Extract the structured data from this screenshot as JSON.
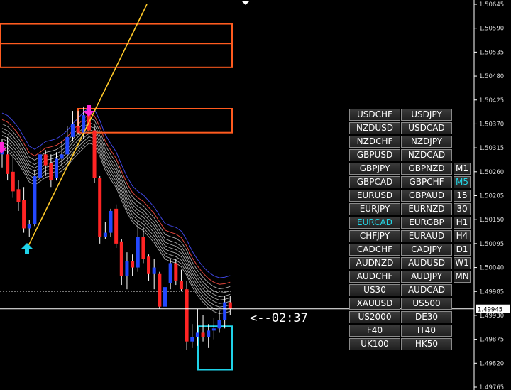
{
  "chart_data": {
    "type": "candlestick",
    "ylim": [
      1.49765,
      1.50645
    ],
    "price_axis": {
      "ticks": [
        1.50645,
        1.5059,
        1.50535,
        1.5048,
        1.50425,
        1.5037,
        1.50315,
        1.5026,
        1.50205,
        1.5015,
        1.50095,
        1.5004,
        1.49985,
        1.4993,
        1.49875,
        1.4982,
        1.49765
      ],
      "tick_labels": [
        "1.50645",
        "1.50590",
        "1.50535",
        "1.50480",
        "1.50425",
        "1.50370",
        "1.50315",
        "1.50260",
        "1.50205",
        "1.50150",
        "1.50095",
        "1.50040",
        "1.49985",
        "1.49930",
        "1.49875",
        "1.49820",
        "1.49765"
      ]
    },
    "current_price": 1.49945,
    "current_price_label": "1.49945",
    "countdown": "<--02:37",
    "candles": [
      {
        "o": 1.503,
        "h": 1.50335,
        "l": 1.5027,
        "c": 1.5032
      },
      {
        "o": 1.503,
        "h": 1.5034,
        "l": 1.5024,
        "c": 1.50255
      },
      {
        "o": 1.5026,
        "h": 1.503,
        "l": 1.502,
        "c": 1.50215
      },
      {
        "o": 1.5022,
        "h": 1.5024,
        "l": 1.5017,
        "c": 1.5019
      },
      {
        "o": 1.50195,
        "h": 1.50225,
        "l": 1.5012,
        "c": 1.5013
      },
      {
        "o": 1.5013,
        "h": 1.5015,
        "l": 1.5011,
        "c": 1.5014
      },
      {
        "o": 1.5014,
        "h": 1.50265,
        "l": 1.50135,
        "c": 1.5025
      },
      {
        "o": 1.50245,
        "h": 1.5032,
        "l": 1.5024,
        "c": 1.503
      },
      {
        "o": 1.503,
        "h": 1.5031,
        "l": 1.5025,
        "c": 1.50275
      },
      {
        "o": 1.5028,
        "h": 1.503,
        "l": 1.50225,
        "c": 1.5024
      },
      {
        "o": 1.50245,
        "h": 1.50305,
        "l": 1.5024,
        "c": 1.5029
      },
      {
        "o": 1.5029,
        "h": 1.5033,
        "l": 1.50275,
        "c": 1.503
      },
      {
        "o": 1.503,
        "h": 1.50365,
        "l": 1.5028,
        "c": 1.5034
      },
      {
        "o": 1.5034,
        "h": 1.504,
        "l": 1.5033,
        "c": 1.5037
      },
      {
        "o": 1.50365,
        "h": 1.504,
        "l": 1.50345,
        "c": 1.5035
      },
      {
        "o": 1.5035,
        "h": 1.5041,
        "l": 1.50335,
        "c": 1.5039
      },
      {
        "o": 1.5039,
        "h": 1.5041,
        "l": 1.5034,
        "c": 1.50355
      },
      {
        "o": 1.50355,
        "h": 1.50365,
        "l": 1.50235,
        "c": 1.50245
      },
      {
        "o": 1.50245,
        "h": 1.5025,
        "l": 1.50095,
        "c": 1.5011
      },
      {
        "o": 1.5011,
        "h": 1.50145,
        "l": 1.50105,
        "c": 1.5012
      },
      {
        "o": 1.5012,
        "h": 1.50175,
        "l": 1.5011,
        "c": 1.5017
      },
      {
        "o": 1.50175,
        "h": 1.50185,
        "l": 1.50085,
        "c": 1.50095
      },
      {
        "o": 1.501,
        "h": 1.50105,
        "l": 1.5,
        "c": 1.5002
      },
      {
        "o": 1.5002,
        "h": 1.50075,
        "l": 1.4999,
        "c": 1.50055
      },
      {
        "o": 1.50055,
        "h": 1.5007,
        "l": 1.5002,
        "c": 1.5004
      },
      {
        "o": 1.5004,
        "h": 1.5015,
        "l": 1.5003,
        "c": 1.5011
      },
      {
        "o": 1.5011,
        "h": 1.5013,
        "l": 1.5005,
        "c": 1.5006
      },
      {
        "o": 1.50065,
        "h": 1.5007,
        "l": 1.5001,
        "c": 1.50025
      },
      {
        "o": 1.50025,
        "h": 1.5006,
        "l": 1.4999,
        "c": 1.5004
      },
      {
        "o": 1.50025,
        "h": 1.5003,
        "l": 1.49945,
        "c": 1.4995
      },
      {
        "o": 1.4995,
        "h": 1.5001,
        "l": 1.4994,
        "c": 1.49995
      },
      {
        "o": 1.50005,
        "h": 1.5006,
        "l": 1.4999,
        "c": 1.5005
      },
      {
        "o": 1.5005,
        "h": 1.5006,
        "l": 1.5,
        "c": 1.5001
      },
      {
        "o": 1.5001,
        "h": 1.50035,
        "l": 1.49985,
        "c": 1.4999
      },
      {
        "o": 1.4999,
        "h": 1.5001,
        "l": 1.4985,
        "c": 1.4987
      },
      {
        "o": 1.4987,
        "h": 1.4991,
        "l": 1.49855,
        "c": 1.4988
      },
      {
        "o": 1.4988,
        "h": 1.49945,
        "l": 1.4986,
        "c": 1.4989
      },
      {
        "o": 1.4989,
        "h": 1.4993,
        "l": 1.4987,
        "c": 1.4988
      },
      {
        "o": 1.4988,
        "h": 1.4991,
        "l": 1.49855,
        "c": 1.49895
      },
      {
        "o": 1.49895,
        "h": 1.49925,
        "l": 1.49875,
        "c": 1.499
      },
      {
        "o": 1.499,
        "h": 1.4994,
        "l": 1.4989,
        "c": 1.4992
      },
      {
        "o": 1.4992,
        "h": 1.49975,
        "l": 1.499,
        "c": 1.4996
      },
      {
        "o": 1.4996,
        "h": 1.49975,
        "l": 1.4993,
        "c": 1.49945
      }
    ],
    "rectangles": [
      {
        "p1": 1.506,
        "p2": 1.50555,
        "color": "#ff5b1f"
      },
      {
        "p1": 1.50555,
        "p2": 1.505,
        "color": "#ff5b1f"
      },
      {
        "p1": 1.50405,
        "p2": 1.5035,
        "color": "#ff5b1f"
      },
      {
        "p1": 1.49905,
        "p2": 1.49805,
        "color": "#1fd2e8"
      }
    ],
    "hlines": [
      1.49985,
      1.505
    ],
    "trendline": {
      "p_start": 1.5008,
      "p_end": 1.50645,
      "color": "#ffc928"
    },
    "arrows": [
      {
        "type": "buy",
        "color": "#1fd2e8"
      },
      {
        "type": "sell",
        "color": "#ff28d8"
      },
      {
        "type": "sell",
        "color": "#ff28d8"
      }
    ],
    "ma_bands": {
      "blue_offset": 0.00085,
      "red_offset": 0.0007,
      "grey_offsets": [
        0.0006,
        0.0005,
        0.00042,
        0.00034,
        0.00026,
        0.00018,
        0.0001,
        3e-05
      ],
      "colors": {
        "blue": "#3f45e0",
        "red": "#e0463c",
        "grey": "#c8c8c8"
      }
    },
    "colors": {
      "bull": "#2448ff",
      "bear": "#ff2424",
      "axis": "#ffffff",
      "bg": "#000000"
    }
  },
  "symbol_panel": {
    "pairs": [
      [
        "USDCHF",
        "USDJPY"
      ],
      [
        "NZDUSD",
        "USDCAD"
      ],
      [
        "NZDCHF",
        "NZDJPY"
      ],
      [
        "GBPUSD",
        "NZDCAD"
      ],
      [
        "GBPJPY",
        "GBPNZD"
      ],
      [
        "GBPCAD",
        "GBPCHF"
      ],
      [
        "EURUSD",
        "GBPAUD"
      ],
      [
        "EURJPY",
        "EURNZD"
      ],
      [
        "EURCAD",
        "EURGBP"
      ],
      [
        "CHFJPY",
        "EURAUD"
      ],
      [
        "CADCHF",
        "CADJPY"
      ],
      [
        "AUDNZD",
        "AUDUSD"
      ],
      [
        "AUDCHF",
        "AUDJPY"
      ],
      [
        "US30",
        "AUDCAD"
      ],
      [
        "XAUUSD",
        "US500"
      ],
      [
        "US2000",
        "DE30"
      ],
      [
        "F40",
        "IT40"
      ],
      [
        "UK100",
        "HK50"
      ]
    ],
    "active_symbol": "EURCAD",
    "timeframes": [
      "M1",
      "M5",
      "15",
      "30",
      "H1",
      "H4",
      "D1",
      "W1",
      "MN"
    ],
    "active_timeframe": "M5"
  }
}
